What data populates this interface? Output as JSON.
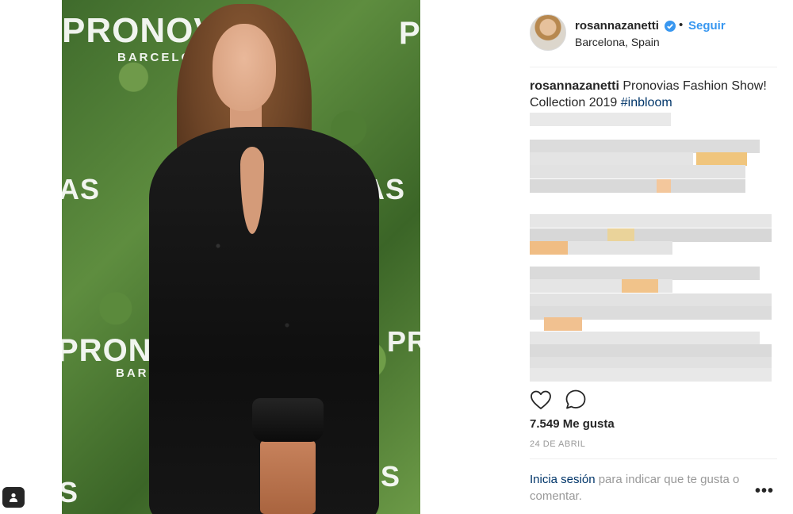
{
  "photo": {
    "brand_text": "PRONOVIAS",
    "brand_sub": "BARCELONA",
    "description_icon": "person-photo"
  },
  "header": {
    "username": "rosannazanetti",
    "separator": "•",
    "follow_label": "Seguir",
    "location": "Barcelona, Spain",
    "verified_icon": "verified-badge-icon",
    "verified_color": "#3897f0"
  },
  "caption": {
    "username": "rosannazanetti",
    "text": "Pronovias Fashion Show! Collection 2019 ",
    "hashtag": "#inbloom"
  },
  "actions": {
    "like_icon": "heart-icon",
    "comment_icon": "comment-icon"
  },
  "likes": "7.549 Me gusta",
  "date": "24 DE ABRIL",
  "login": {
    "link": "Inicia sesión",
    "rest": " para indicar que te gusta o comentar."
  },
  "more_label": "•••",
  "colors": {
    "link_blue": "#3897f0",
    "dark_link": "#003569",
    "text": "#262626",
    "muted": "#999999"
  }
}
